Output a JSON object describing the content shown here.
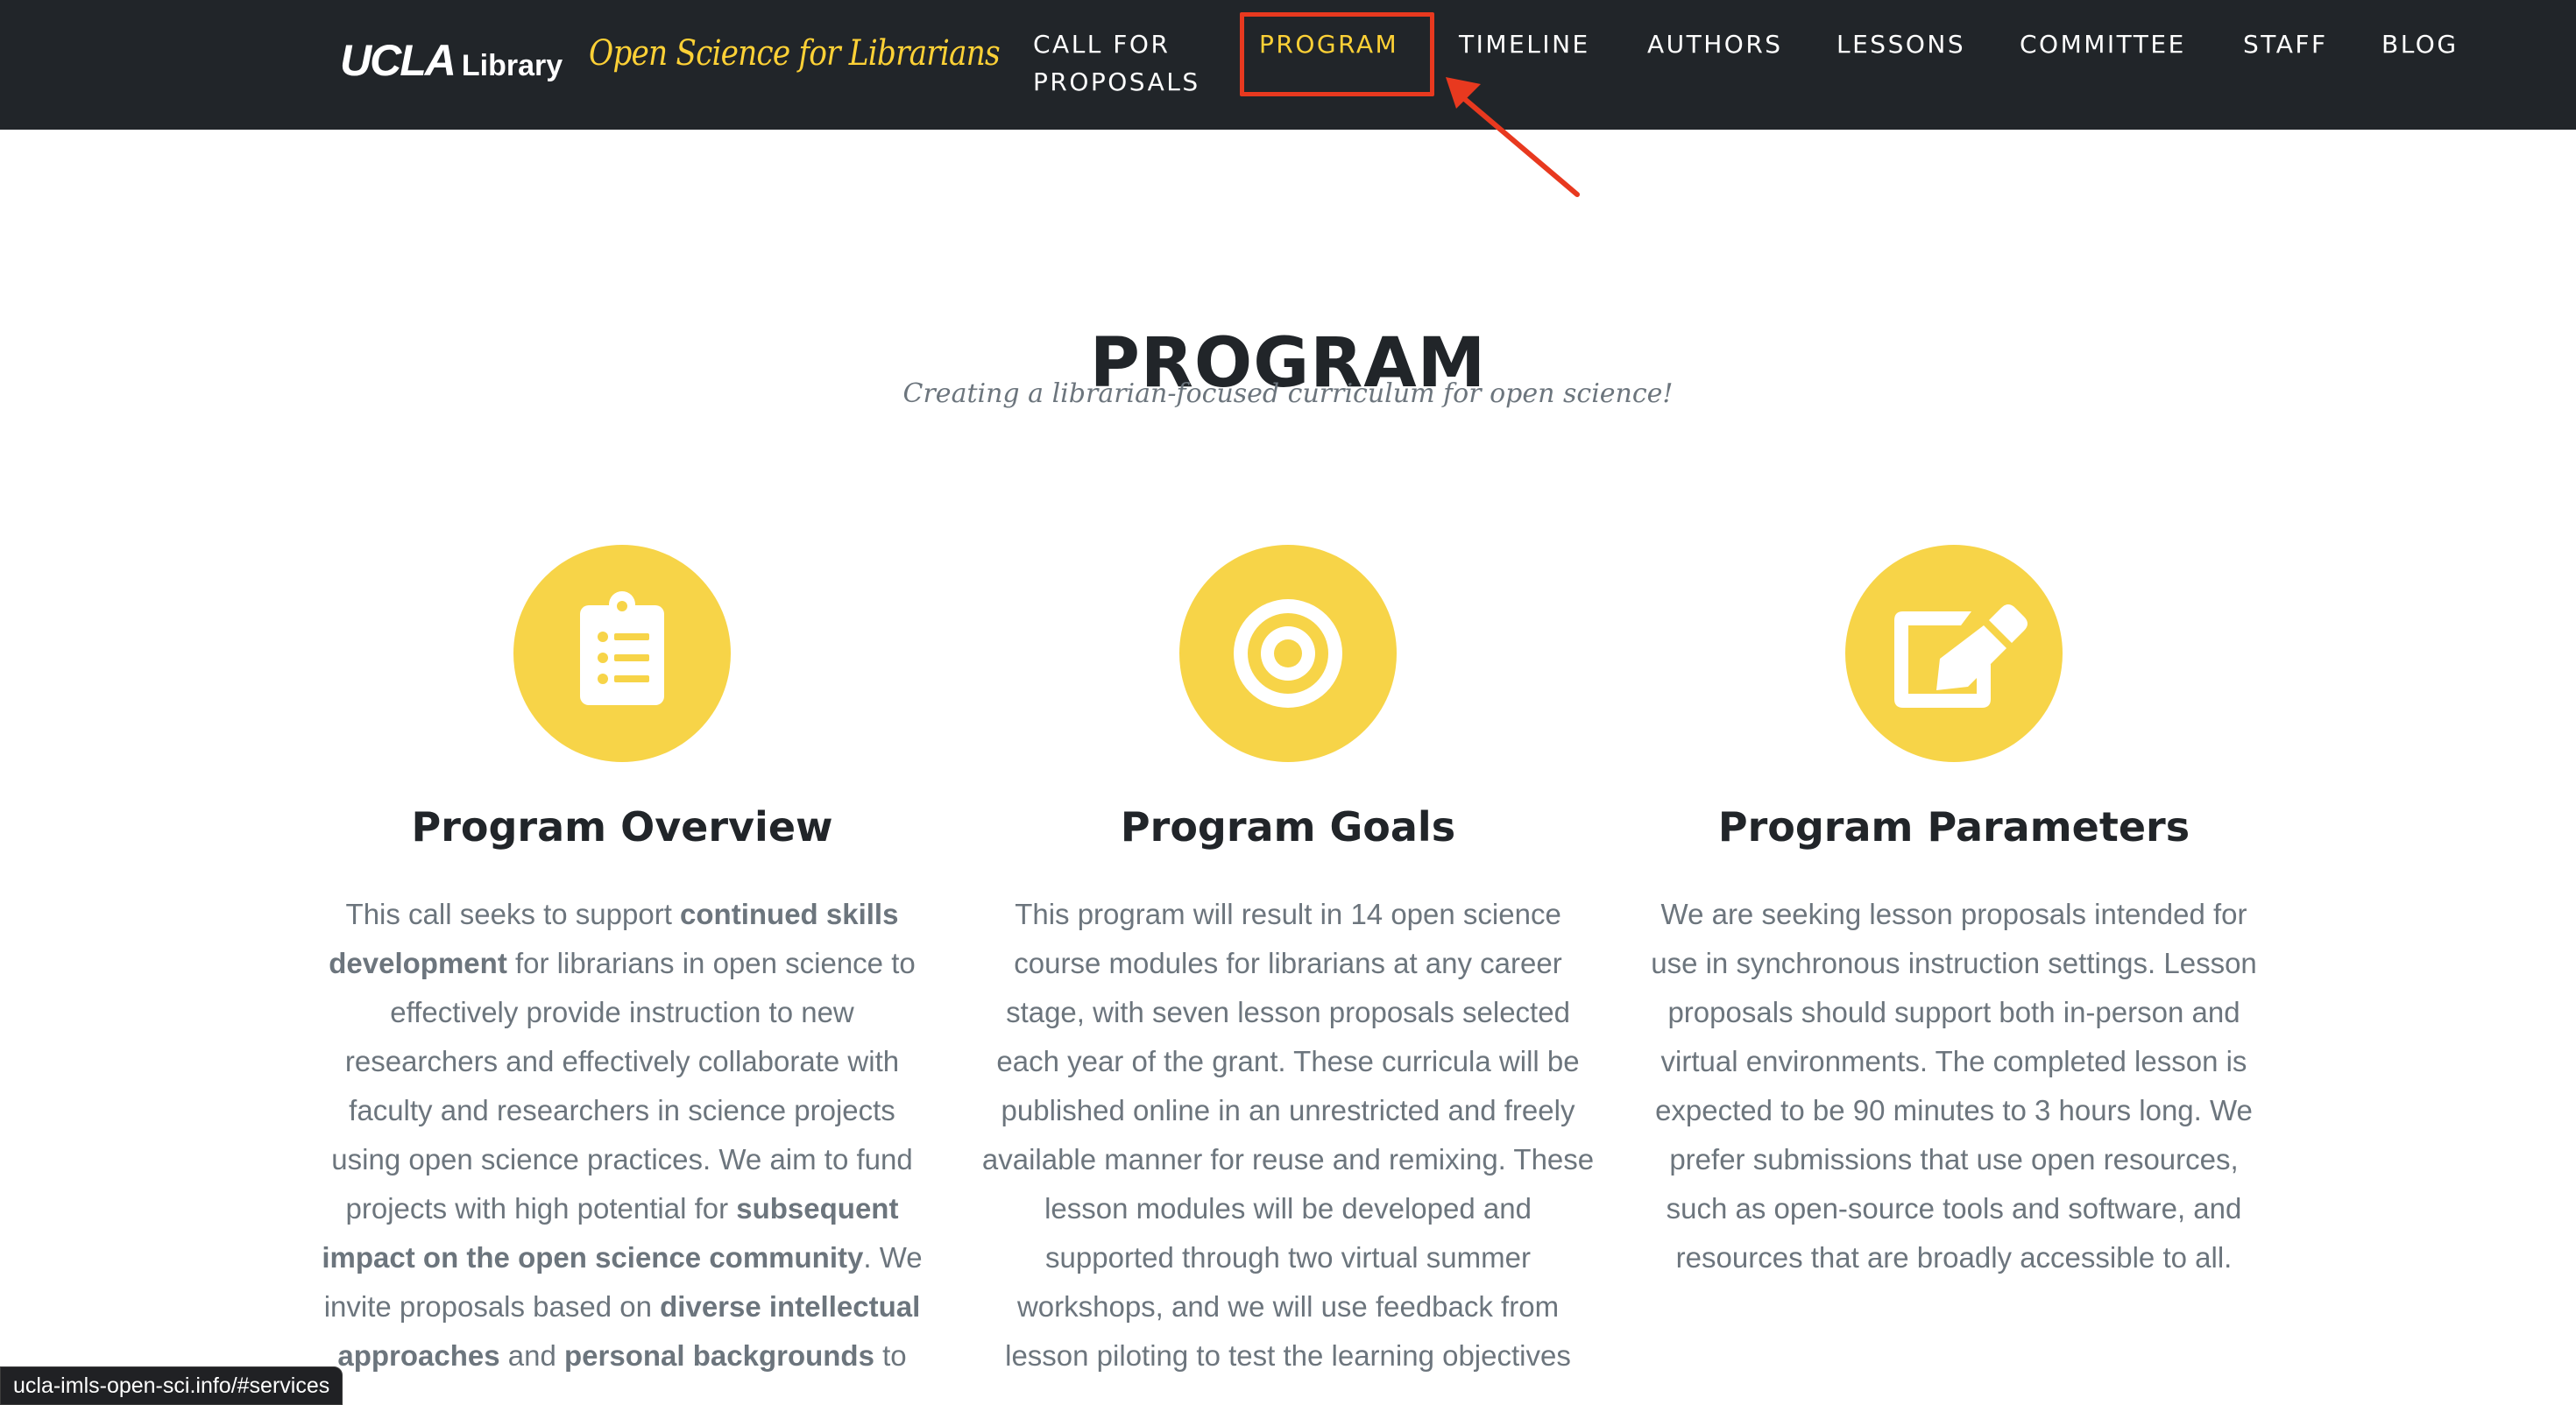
{
  "navbar": {
    "logo": {
      "primary": "UCLA",
      "secondary": "Library"
    },
    "brand": "Open Science for Librarians",
    "items": [
      {
        "label_lines": [
          "CALL FOR",
          "PROPOSALS"
        ],
        "active": false
      },
      {
        "label_lines": [
          "PROGRAM"
        ],
        "active": true
      },
      {
        "label_lines": [
          "TIMELINE"
        ],
        "active": false
      },
      {
        "label_lines": [
          "AUTHORS"
        ],
        "active": false
      },
      {
        "label_lines": [
          "LESSONS"
        ],
        "active": false
      },
      {
        "label_lines": [
          "COMMITTEE"
        ],
        "active": false
      },
      {
        "label_lines": [
          "STAFF"
        ],
        "active": false
      },
      {
        "label_lines": [
          "BLOG"
        ],
        "active": false
      }
    ]
  },
  "annotation": {
    "target": "PROGRAM",
    "color": "#e8391f"
  },
  "section": {
    "heading": "PROGRAM",
    "subheading": "Creating a librarian-focused curriculum for open science!"
  },
  "columns": [
    {
      "icon": "clipboard-list-icon",
      "heading": "Program Overview",
      "lines": [
        [
          {
            "t": "This call seeks to support "
          },
          {
            "t": "continued skills",
            "b": true
          }
        ],
        [
          {
            "t": "development",
            "b": true
          },
          {
            "t": " for librarians in open science to"
          }
        ],
        [
          {
            "t": "effectively provide instruction to new"
          }
        ],
        [
          {
            "t": "researchers and effectively collaborate with"
          }
        ],
        [
          {
            "t": "faculty and researchers in science projects"
          }
        ],
        [
          {
            "t": "using open science practices. We aim to fund"
          }
        ],
        [
          {
            "t": "projects with high potential for "
          },
          {
            "t": "subsequent",
            "b": true
          }
        ],
        [
          {
            "t": "impact on the open science community",
            "b": true
          },
          {
            "t": ". We"
          }
        ],
        [
          {
            "t": "invite proposals based on "
          },
          {
            "t": "diverse intellectual",
            "b": true
          }
        ],
        [
          {
            "t": "approaches",
            "b": true
          },
          {
            "t": " and "
          },
          {
            "t": "personal backgrounds",
            "b": true
          },
          {
            "t": " to"
          }
        ]
      ]
    },
    {
      "icon": "bullseye-icon",
      "heading": "Program Goals",
      "lines": [
        [
          {
            "t": "This program will result in 14 open science"
          }
        ],
        [
          {
            "t": "course modules for librarians at any career"
          }
        ],
        [
          {
            "t": "stage, with seven lesson proposals selected"
          }
        ],
        [
          {
            "t": "each year of the grant. These curricula will be"
          }
        ],
        [
          {
            "t": "published online in an unrestricted and freely"
          }
        ],
        [
          {
            "t": "available manner for reuse and remixing. These"
          }
        ],
        [
          {
            "t": "lesson modules will be developed and"
          }
        ],
        [
          {
            "t": "supported through two virtual summer"
          }
        ],
        [
          {
            "t": "workshops, and we will use feedback from"
          }
        ],
        [
          {
            "t": "lesson piloting to test the learning objectives"
          }
        ]
      ]
    },
    {
      "icon": "edit-pencil-icon",
      "heading": "Program Parameters",
      "lines": [
        [
          {
            "t": "We are seeking lesson proposals intended for"
          }
        ],
        [
          {
            "t": "use in synchronous instruction settings. Lesson"
          }
        ],
        [
          {
            "t": "proposals should support both in-person and"
          }
        ],
        [
          {
            "t": "virtual environments. The completed lesson is"
          }
        ],
        [
          {
            "t": "expected to be 90 minutes to 3 hours long. We"
          }
        ],
        [
          {
            "t": "prefer submissions that use open resources,"
          }
        ],
        [
          {
            "t": "such as open-source tools and software, and"
          }
        ],
        [
          {
            "t": "resources that are broadly accessible to all."
          }
        ]
      ]
    }
  ],
  "colors": {
    "navbar_bg": "#212529",
    "accent_yellow": "#fed136",
    "icon_circle": "#f7d448",
    "heading": "#212529",
    "muted_text": "#6c757d"
  },
  "status_bar": {
    "url": "ucla-imls-open-sci.info/#services"
  }
}
